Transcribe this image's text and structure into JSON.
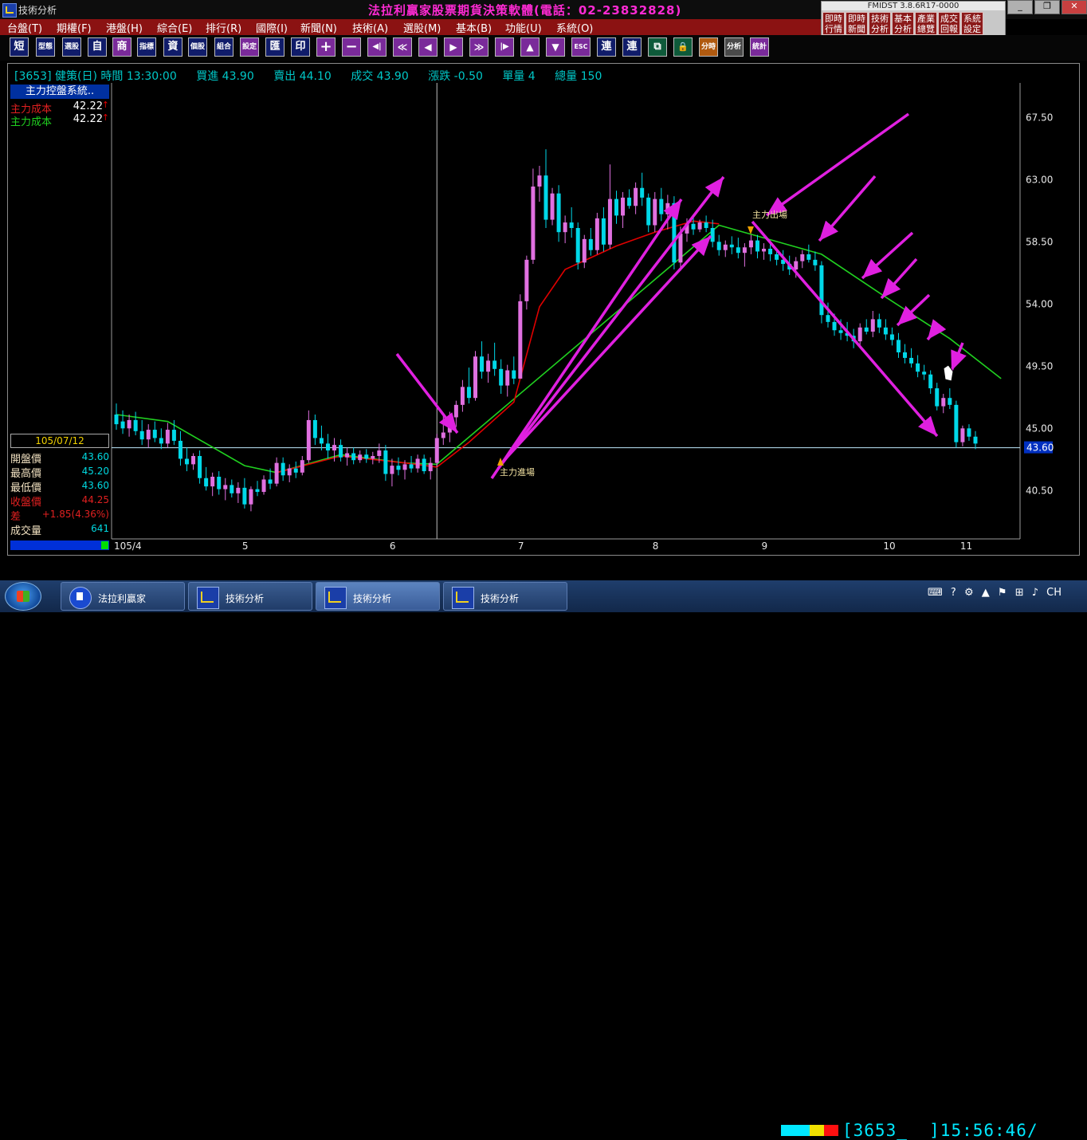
{
  "window": {
    "title": "技術分析",
    "brand": "法拉利贏家股票期貨決策軟體(電話：02-23832828)"
  },
  "fmid": {
    "version": "FMIDST 3.8.6R17-0000",
    "buttons": [
      "即時行情",
      "即時新聞",
      "技術分析",
      "基本分析",
      "產業總覽",
      "成交回報",
      "系統設定"
    ]
  },
  "menu": [
    "台盤(T)",
    "期權(F)",
    "港盤(H)",
    "綜合(E)",
    "排行(R)",
    "國際(I)",
    "新聞(N)",
    "技術(A)",
    "選股(M)",
    "基本(B)",
    "功能(U)",
    "系統(O)"
  ],
  "toolbar": [
    "短",
    "型態",
    "選股",
    "自",
    "商",
    "指標",
    "資",
    "個股",
    "組合",
    "設定",
    "匯",
    "印",
    "+",
    "−",
    "◀|",
    "≪",
    "◀",
    "▶",
    "≫",
    "|▶",
    "▲",
    "▼",
    "ESC",
    "連",
    "連",
    "⧉",
    "🔒",
    "分時",
    "分析",
    "統計"
  ],
  "header": {
    "code": "[3653]",
    "name": "健策(日)",
    "time_label": "時間",
    "time": "13:30:00",
    "bid_label": "買進",
    "bid": "43.90",
    "ask_label": "賣出",
    "ask": "44.10",
    "deal_label": "成交",
    "deal": "43.90",
    "change_label": "漲跌",
    "change": "-0.50",
    "vol_label": "單量",
    "vol": "4",
    "total_label": "總量",
    "total": "150"
  },
  "side_panel": {
    "title": "主力控盤系統..",
    "rows": [
      {
        "label": "主力成本",
        "value": "42.22",
        "arrow": "↑",
        "color": "#e02020"
      },
      {
        "label": "主力成本",
        "value": "42.22",
        "arrow": "↑",
        "color": "#20d020"
      }
    ]
  },
  "stats": {
    "date": "105/07/12",
    "rows": [
      {
        "label": "開盤價",
        "value": "43.60"
      },
      {
        "label": "最高價",
        "value": "45.20"
      },
      {
        "label": "最低價",
        "value": "43.60"
      },
      {
        "label": "收盤價",
        "value": "44.25"
      },
      {
        "label": "差",
        "value": "+1.85(4.36%)"
      },
      {
        "label": "成交量",
        "value": "641"
      }
    ]
  },
  "status": {
    "code": "[3653_  ]",
    "clock": "15:56:46/"
  },
  "taskbar": {
    "items": [
      "法拉利贏家",
      "技術分析",
      "技術分析",
      "技術分析"
    ],
    "tray_lang": "CH"
  },
  "chart_data": {
    "type": "candlestick",
    "ylim": [
      37.0,
      70.0
    ],
    "y_ticks": [
      "67.50",
      "63.00",
      "58.50",
      "54.00",
      "49.50",
      "45.00",
      "40.50"
    ],
    "x_ticks": [
      "105/4",
      "5",
      "6",
      "7",
      "8",
      "9",
      "10",
      "11"
    ],
    "last_price_label": "43.60",
    "annotations": [
      "主力進場",
      "主力出場"
    ],
    "colors": {
      "up": "#e070e0",
      "down": "#00d8e8",
      "ma_green": "#20d020",
      "ma_red": "#e00000",
      "arrows": "#e020e0"
    },
    "candles": [
      {
        "o": 46.0,
        "h": 46.8,
        "l": 44.9,
        "c": 45.3
      },
      {
        "o": 45.5,
        "h": 46.3,
        "l": 44.6,
        "c": 45.0
      },
      {
        "o": 45.0,
        "h": 46.0,
        "l": 44.4,
        "c": 45.6
      },
      {
        "o": 45.6,
        "h": 46.2,
        "l": 44.5,
        "c": 44.8
      },
      {
        "o": 44.8,
        "h": 45.6,
        "l": 43.8,
        "c": 44.2
      },
      {
        "o": 44.2,
        "h": 45.3,
        "l": 43.6,
        "c": 44.9
      },
      {
        "o": 44.9,
        "h": 45.5,
        "l": 44.0,
        "c": 44.3
      },
      {
        "o": 44.3,
        "h": 45.0,
        "l": 43.5,
        "c": 43.9
      },
      {
        "o": 43.9,
        "h": 45.4,
        "l": 43.6,
        "c": 44.9
      },
      {
        "o": 44.9,
        "h": 45.6,
        "l": 43.8,
        "c": 44.1
      },
      {
        "o": 44.1,
        "h": 44.8,
        "l": 42.3,
        "c": 42.8
      },
      {
        "o": 42.8,
        "h": 43.6,
        "l": 41.9,
        "c": 42.4
      },
      {
        "o": 42.4,
        "h": 43.2,
        "l": 42.0,
        "c": 43.0
      },
      {
        "o": 43.0,
        "h": 43.4,
        "l": 41.0,
        "c": 41.4
      },
      {
        "o": 41.4,
        "h": 42.2,
        "l": 40.5,
        "c": 40.8
      },
      {
        "o": 40.8,
        "h": 41.8,
        "l": 40.1,
        "c": 41.5
      },
      {
        "o": 41.5,
        "h": 41.9,
        "l": 40.2,
        "c": 40.6
      },
      {
        "o": 40.6,
        "h": 41.4,
        "l": 39.8,
        "c": 40.9
      },
      {
        "o": 40.9,
        "h": 41.3,
        "l": 40.0,
        "c": 40.3
      },
      {
        "o": 40.3,
        "h": 41.1,
        "l": 39.6,
        "c": 40.7
      },
      {
        "o": 40.7,
        "h": 41.4,
        "l": 39.2,
        "c": 39.5
      },
      {
        "o": 39.5,
        "h": 40.8,
        "l": 39.0,
        "c": 40.6
      },
      {
        "o": 40.6,
        "h": 41.2,
        "l": 40.1,
        "c": 40.4
      },
      {
        "o": 40.4,
        "h": 41.6,
        "l": 40.2,
        "c": 41.3
      },
      {
        "o": 41.3,
        "h": 42.1,
        "l": 40.6,
        "c": 41.0
      },
      {
        "o": 41.0,
        "h": 42.9,
        "l": 40.8,
        "c": 42.5
      },
      {
        "o": 42.5,
        "h": 42.9,
        "l": 41.2,
        "c": 41.6
      },
      {
        "o": 41.6,
        "h": 42.4,
        "l": 41.1,
        "c": 42.1
      },
      {
        "o": 42.1,
        "h": 42.6,
        "l": 41.4,
        "c": 41.8
      },
      {
        "o": 41.8,
        "h": 43.0,
        "l": 41.6,
        "c": 42.7
      },
      {
        "o": 42.7,
        "h": 46.3,
        "l": 42.5,
        "c": 45.6
      },
      {
        "o": 45.6,
        "h": 46.0,
        "l": 43.8,
        "c": 44.3
      },
      {
        "o": 44.3,
        "h": 45.2,
        "l": 43.4,
        "c": 43.9
      },
      {
        "o": 43.9,
        "h": 44.6,
        "l": 42.8,
        "c": 43.4
      },
      {
        "o": 43.4,
        "h": 44.3,
        "l": 42.6,
        "c": 43.8
      },
      {
        "o": 43.8,
        "h": 44.2,
        "l": 42.6,
        "c": 42.9
      },
      {
        "o": 42.9,
        "h": 43.6,
        "l": 42.3,
        "c": 43.2
      },
      {
        "o": 43.2,
        "h": 43.6,
        "l": 42.4,
        "c": 42.7
      },
      {
        "o": 42.7,
        "h": 43.4,
        "l": 42.5,
        "c": 43.1
      },
      {
        "o": 43.1,
        "h": 43.5,
        "l": 42.5,
        "c": 42.8
      },
      {
        "o": 42.8,
        "h": 43.3,
        "l": 42.4,
        "c": 43.0
      },
      {
        "o": 43.0,
        "h": 43.9,
        "l": 42.5,
        "c": 43.4
      },
      {
        "o": 43.4,
        "h": 43.8,
        "l": 41.2,
        "c": 41.7
      },
      {
        "o": 41.7,
        "h": 42.8,
        "l": 40.8,
        "c": 42.3
      },
      {
        "o": 42.3,
        "h": 42.9,
        "l": 41.6,
        "c": 42.0
      },
      {
        "o": 42.0,
        "h": 42.7,
        "l": 41.3,
        "c": 42.4
      },
      {
        "o": 42.4,
        "h": 43.0,
        "l": 41.8,
        "c": 42.1
      },
      {
        "o": 42.1,
        "h": 43.1,
        "l": 41.8,
        "c": 42.8
      },
      {
        "o": 42.8,
        "h": 43.1,
        "l": 41.7,
        "c": 41.9
      },
      {
        "o": 41.9,
        "h": 42.9,
        "l": 41.3,
        "c": 42.5
      },
      {
        "o": 42.5,
        "h": 44.6,
        "l": 42.2,
        "c": 44.3
      },
      {
        "o": 44.3,
        "h": 45.9,
        "l": 43.8,
        "c": 44.7
      },
      {
        "o": 44.7,
        "h": 46.2,
        "l": 44.0,
        "c": 45.8
      },
      {
        "o": 45.8,
        "h": 47.0,
        "l": 45.1,
        "c": 46.7
      },
      {
        "o": 46.7,
        "h": 48.5,
        "l": 46.2,
        "c": 48.0
      },
      {
        "o": 48.0,
        "h": 49.4,
        "l": 46.8,
        "c": 47.2
      },
      {
        "o": 47.2,
        "h": 50.6,
        "l": 47.0,
        "c": 50.2
      },
      {
        "o": 50.2,
        "h": 51.3,
        "l": 48.6,
        "c": 49.1
      },
      {
        "o": 49.1,
        "h": 50.4,
        "l": 48.3,
        "c": 49.9
      },
      {
        "o": 49.9,
        "h": 51.2,
        "l": 48.8,
        "c": 49.3
      },
      {
        "o": 49.3,
        "h": 50.0,
        "l": 47.5,
        "c": 48.1
      },
      {
        "o": 48.1,
        "h": 49.6,
        "l": 47.3,
        "c": 49.2
      },
      {
        "o": 49.2,
        "h": 50.2,
        "l": 48.2,
        "c": 48.6
      },
      {
        "o": 48.6,
        "h": 54.7,
        "l": 52.8,
        "c": 54.2
      },
      {
        "o": 54.2,
        "h": 57.5,
        "l": 53.6,
        "c": 57.2
      },
      {
        "o": 57.2,
        "h": 63.8,
        "l": 56.9,
        "c": 62.5
      },
      {
        "o": 62.5,
        "h": 64.0,
        "l": 61.4,
        "c": 63.3
      },
      {
        "o": 63.3,
        "h": 65.2,
        "l": 59.5,
        "c": 60.1
      },
      {
        "o": 60.1,
        "h": 62.4,
        "l": 59.7,
        "c": 62.0
      },
      {
        "o": 62.0,
        "h": 62.6,
        "l": 58.5,
        "c": 59.2
      },
      {
        "o": 59.2,
        "h": 60.4,
        "l": 58.4,
        "c": 59.9
      },
      {
        "o": 59.9,
        "h": 61.0,
        "l": 58.8,
        "c": 59.5
      },
      {
        "o": 59.5,
        "h": 59.9,
        "l": 56.5,
        "c": 57.0
      },
      {
        "o": 57.0,
        "h": 59.0,
        "l": 56.6,
        "c": 58.7
      },
      {
        "o": 58.7,
        "h": 59.5,
        "l": 57.5,
        "c": 57.9
      },
      {
        "o": 57.9,
        "h": 60.6,
        "l": 57.6,
        "c": 60.2
      },
      {
        "o": 60.2,
        "h": 61.0,
        "l": 57.8,
        "c": 58.3
      },
      {
        "o": 58.3,
        "h": 64.1,
        "l": 58.0,
        "c": 61.6
      },
      {
        "o": 61.6,
        "h": 62.2,
        "l": 59.8,
        "c": 60.4
      },
      {
        "o": 60.4,
        "h": 62.1,
        "l": 59.5,
        "c": 61.7
      },
      {
        "o": 61.7,
        "h": 62.3,
        "l": 60.9,
        "c": 61.1
      },
      {
        "o": 61.1,
        "h": 62.8,
        "l": 60.5,
        "c": 62.4
      },
      {
        "o": 62.4,
        "h": 63.5,
        "l": 61.1,
        "c": 61.7
      },
      {
        "o": 61.7,
        "h": 62.0,
        "l": 59.2,
        "c": 59.7
      },
      {
        "o": 59.7,
        "h": 62.1,
        "l": 59.2,
        "c": 61.6
      },
      {
        "o": 61.6,
        "h": 62.4,
        "l": 60.0,
        "c": 60.5
      },
      {
        "o": 60.5,
        "h": 61.9,
        "l": 59.4,
        "c": 61.3
      },
      {
        "o": 61.3,
        "h": 61.8,
        "l": 56.5,
        "c": 57.0
      },
      {
        "o": 57.0,
        "h": 59.6,
        "l": 56.4,
        "c": 59.1
      },
      {
        "o": 59.1,
        "h": 60.2,
        "l": 58.5,
        "c": 59.8
      },
      {
        "o": 59.8,
        "h": 60.3,
        "l": 59.0,
        "c": 59.4
      },
      {
        "o": 59.4,
        "h": 60.1,
        "l": 59.2,
        "c": 59.9
      },
      {
        "o": 59.9,
        "h": 60.4,
        "l": 59.2,
        "c": 59.5
      },
      {
        "o": 59.5,
        "h": 60.1,
        "l": 58.1,
        "c": 58.5
      },
      {
        "o": 58.5,
        "h": 59.0,
        "l": 57.5,
        "c": 57.9
      },
      {
        "o": 57.9,
        "h": 58.6,
        "l": 57.4,
        "c": 58.3
      },
      {
        "o": 58.3,
        "h": 58.9,
        "l": 57.6,
        "c": 58.1
      },
      {
        "o": 58.1,
        "h": 58.8,
        "l": 57.3,
        "c": 57.7
      },
      {
        "o": 57.7,
        "h": 58.4,
        "l": 56.7,
        "c": 58.1
      },
      {
        "o": 58.1,
        "h": 59.0,
        "l": 57.6,
        "c": 58.6
      },
      {
        "o": 58.6,
        "h": 59.0,
        "l": 57.3,
        "c": 57.8
      },
      {
        "o": 57.8,
        "h": 58.4,
        "l": 57.2,
        "c": 58.0
      },
      {
        "o": 58.0,
        "h": 58.4,
        "l": 57.1,
        "c": 57.6
      },
      {
        "o": 57.6,
        "h": 58.0,
        "l": 56.8,
        "c": 57.2
      },
      {
        "o": 57.2,
        "h": 57.9,
        "l": 56.4,
        "c": 56.9
      },
      {
        "o": 56.9,
        "h": 57.5,
        "l": 56.1,
        "c": 56.5
      },
      {
        "o": 56.5,
        "h": 57.4,
        "l": 55.9,
        "c": 57.1
      },
      {
        "o": 57.1,
        "h": 57.9,
        "l": 56.6,
        "c": 57.6
      },
      {
        "o": 57.6,
        "h": 58.3,
        "l": 57.0,
        "c": 57.2
      },
      {
        "o": 57.2,
        "h": 57.8,
        "l": 56.4,
        "c": 56.8
      },
      {
        "o": 56.8,
        "h": 57.1,
        "l": 52.6,
        "c": 53.2
      },
      {
        "o": 53.2,
        "h": 54.1,
        "l": 52.3,
        "c": 52.7
      },
      {
        "o": 52.7,
        "h": 53.3,
        "l": 51.7,
        "c": 52.1
      },
      {
        "o": 52.1,
        "h": 52.9,
        "l": 51.4,
        "c": 51.9
      },
      {
        "o": 51.9,
        "h": 52.7,
        "l": 51.3,
        "c": 51.7
      },
      {
        "o": 51.7,
        "h": 52.2,
        "l": 50.8,
        "c": 51.3
      },
      {
        "o": 51.3,
        "h": 52.6,
        "l": 50.9,
        "c": 52.3
      },
      {
        "o": 52.3,
        "h": 52.9,
        "l": 51.8,
        "c": 52.0
      },
      {
        "o": 52.0,
        "h": 53.5,
        "l": 51.6,
        "c": 52.9
      },
      {
        "o": 52.9,
        "h": 53.3,
        "l": 51.9,
        "c": 52.3
      },
      {
        "o": 52.3,
        "h": 52.9,
        "l": 51.4,
        "c": 51.8
      },
      {
        "o": 51.8,
        "h": 52.3,
        "l": 51.0,
        "c": 51.4
      },
      {
        "o": 51.4,
        "h": 51.9,
        "l": 50.1,
        "c": 50.5
      },
      {
        "o": 50.5,
        "h": 51.1,
        "l": 49.7,
        "c": 50.1
      },
      {
        "o": 50.1,
        "h": 50.8,
        "l": 49.4,
        "c": 49.7
      },
      {
        "o": 49.7,
        "h": 50.3,
        "l": 48.7,
        "c": 49.1
      },
      {
        "o": 49.1,
        "h": 49.6,
        "l": 48.5,
        "c": 48.9
      },
      {
        "o": 48.9,
        "h": 49.2,
        "l": 47.5,
        "c": 47.9
      },
      {
        "o": 47.9,
        "h": 48.3,
        "l": 46.3,
        "c": 46.6
      },
      {
        "o": 46.6,
        "h": 47.5,
        "l": 46.1,
        "c": 47.2
      },
      {
        "o": 47.2,
        "h": 47.9,
        "l": 46.4,
        "c": 46.7
      },
      {
        "o": 46.7,
        "h": 47.0,
        "l": 43.6,
        "c": 44.0
      },
      {
        "o": 44.0,
        "h": 45.2,
        "l": 43.7,
        "c": 45.0
      },
      {
        "o": 45.0,
        "h": 45.3,
        "l": 44.1,
        "c": 44.4
      },
      {
        "o": 44.4,
        "h": 44.8,
        "l": 43.5,
        "c": 43.9
      }
    ],
    "ma_green": [
      [
        0,
        46.0
      ],
      [
        8,
        45.5
      ],
      [
        20,
        42.3
      ],
      [
        25,
        41.8
      ],
      [
        35,
        43.1
      ],
      [
        45,
        42.5
      ],
      [
        50,
        42.4
      ],
      [
        94,
        59.7
      ],
      [
        110,
        57.6
      ],
      [
        120,
        54.5
      ],
      [
        130,
        51.5
      ],
      [
        138,
        48.6
      ]
    ],
    "ma_red": [
      [
        25,
        41.8
      ],
      [
        35,
        43.0
      ],
      [
        45,
        42.5
      ],
      [
        50,
        42.2
      ],
      [
        55,
        44.0
      ],
      [
        62,
        46.9
      ],
      [
        66,
        53.8
      ],
      [
        70,
        56.5
      ],
      [
        78,
        58.2
      ],
      [
        84,
        59.2
      ],
      [
        90,
        60.0
      ],
      [
        94,
        59.8
      ]
    ],
    "entry_index": 50,
    "exit_index": 90,
    "last_price": 43.6
  }
}
